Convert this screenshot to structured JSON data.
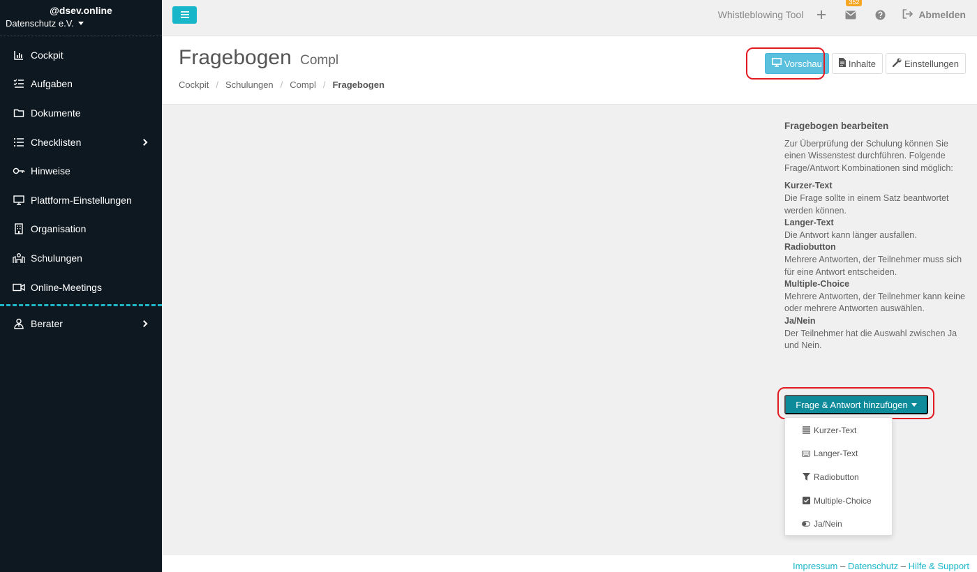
{
  "sidebar": {
    "user": "@dsev.online",
    "org": "Datenschutz e.V.",
    "items": [
      {
        "label": "Cockpit",
        "icon": "chart-icon"
      },
      {
        "label": "Aufgaben",
        "icon": "tasks-icon"
      },
      {
        "label": "Dokumente",
        "icon": "folder-icon"
      },
      {
        "label": "Checklisten",
        "icon": "list-icon"
      },
      {
        "label": "Hinweise",
        "icon": "key-icon"
      },
      {
        "label": "Plattform-Einstellungen",
        "icon": "monitor-icon"
      },
      {
        "label": "Organisation",
        "icon": "building-icon"
      },
      {
        "label": "Schulungen",
        "icon": "training-icon"
      },
      {
        "label": "Online-Meetings",
        "icon": "video-icon"
      }
    ],
    "berater": "Berater"
  },
  "topbar": {
    "whistleblowing": "Whistleblowing Tool",
    "mail_count": "352",
    "logout": "Abmelden"
  },
  "header": {
    "title": "Fragebogen",
    "subtitle": "Compl",
    "breadcrumb": [
      "Cockpit",
      "Schulungen",
      "Compl",
      "Fragebogen"
    ],
    "buttons": {
      "preview": "Vorschau",
      "content": "Inhalte",
      "settings": "Einstellungen"
    }
  },
  "help": {
    "title": "Fragebogen bearbeiten",
    "intro": "Zur Überprüfung der Schulung können Sie einen Wissenstest durchführen. Folgende Frage/Antwort Kombinationen sind möglich:",
    "types": [
      {
        "term": "Kurzer-Text",
        "desc": "Die Frage sollte in einem Satz beantwortet werden können."
      },
      {
        "term": "Langer-Text",
        "desc": "Die Antwort kann länger ausfallen."
      },
      {
        "term": "Radiobutton",
        "desc": "Mehrere Antworten, der Teilnehmer muss sich für eine Antwort entscheiden."
      },
      {
        "term": "Multiple-Choice",
        "desc": "Mehrere Antworten, der Teilnehmer kann keine oder mehrere Antworten auswählen."
      },
      {
        "term": "Ja/Nein",
        "desc": "Der Teilnehmer hat die Auswahl zwischen Ja und Nein."
      }
    ]
  },
  "add_button": "Frage & Antwort hinzufügen",
  "dropdown": [
    {
      "label": "Kurzer-Text",
      "icon": "align-justify-icon"
    },
    {
      "label": "Langer-Text",
      "icon": "keyboard-icon"
    },
    {
      "label": "Radiobutton",
      "icon": "filter-icon"
    },
    {
      "label": "Multiple-Choice",
      "icon": "checkbox-icon"
    },
    {
      "label": "Ja/Nein",
      "icon": "toggle-icon"
    }
  ],
  "footer": {
    "impressum": "Impressum",
    "datenschutz": "Datenschutz",
    "hilfe": "Hilfe & Support",
    "sep": "–"
  },
  "colors": {
    "sidebar_bg": "#0e1820",
    "accent": "#17b6c9",
    "primary_dark": "#0d8b9a",
    "info": "#5bc0de",
    "badge": "#f5a623",
    "highlight": "#e21b23"
  }
}
